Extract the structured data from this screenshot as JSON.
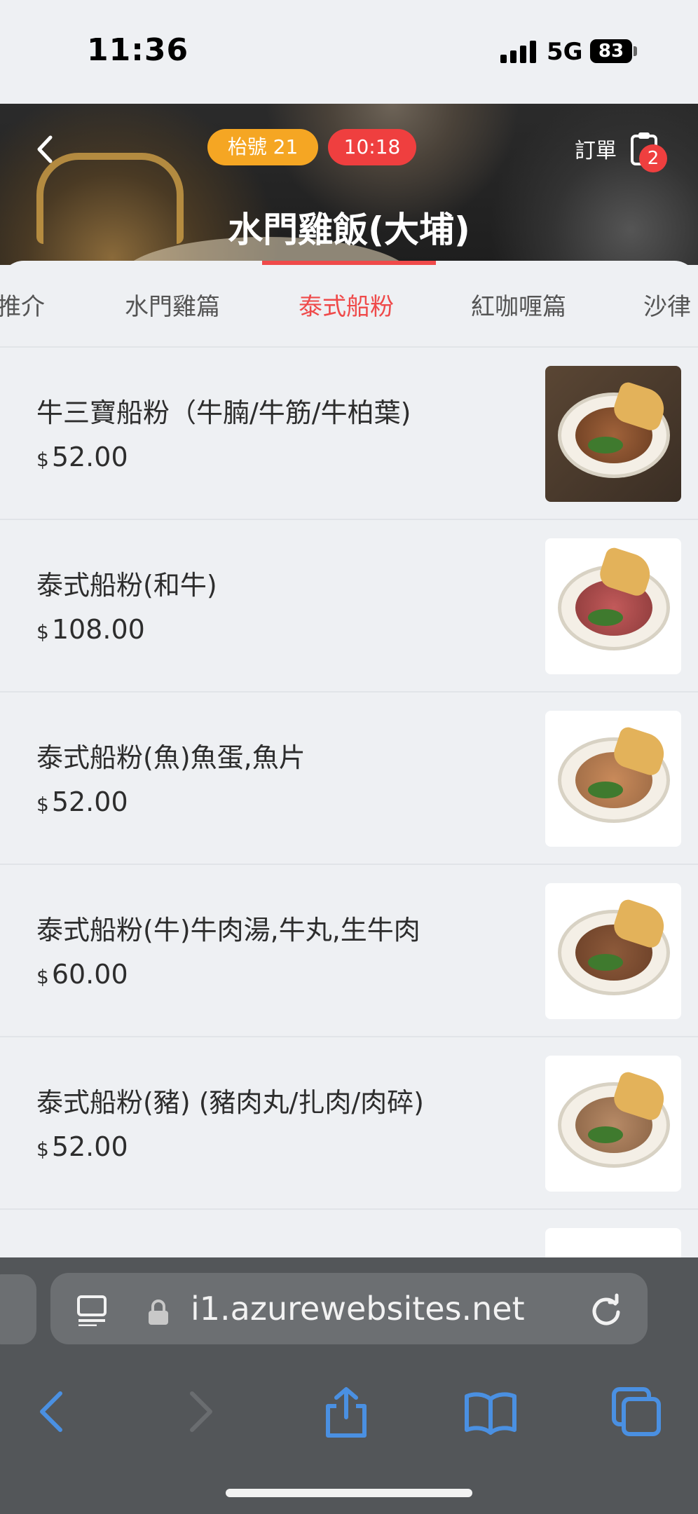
{
  "status": {
    "time": "11:36",
    "network": "5G",
    "battery": "83"
  },
  "header": {
    "table_pill": "枱號 21",
    "time_pill": "10:18",
    "order_label": "訂單",
    "order_count": "2",
    "store_name": "水門雞飯(大埔)"
  },
  "tabs": [
    {
      "label": "推介"
    },
    {
      "label": "水門雞篇"
    },
    {
      "label": "泰式船粉",
      "active": true
    },
    {
      "label": "紅咖喱篇"
    },
    {
      "label": "沙律"
    }
  ],
  "menu": [
    {
      "name": "牛三寶船粉（牛腩/牛筋/牛柏葉)",
      "currency": "$",
      "price": "52.00"
    },
    {
      "name": "泰式船粉(和牛)",
      "currency": "$",
      "price": "108.00"
    },
    {
      "name": "泰式船粉(魚)魚蛋,魚片",
      "currency": "$",
      "price": "52.00"
    },
    {
      "name": "泰式船粉(牛)牛肉湯,牛丸,生牛肉",
      "currency": "$",
      "price": "60.00"
    },
    {
      "name": "泰式船粉(豬) (豬肉丸/扎肉/肉碎)",
      "currency": "$",
      "price": "52.00"
    }
  ],
  "browser": {
    "url": "i1.azurewebsites.net"
  },
  "colors": {
    "accent": "#ef4a4a",
    "table_pill": "#f5a623",
    "browser_icon": "#4a90e2"
  }
}
